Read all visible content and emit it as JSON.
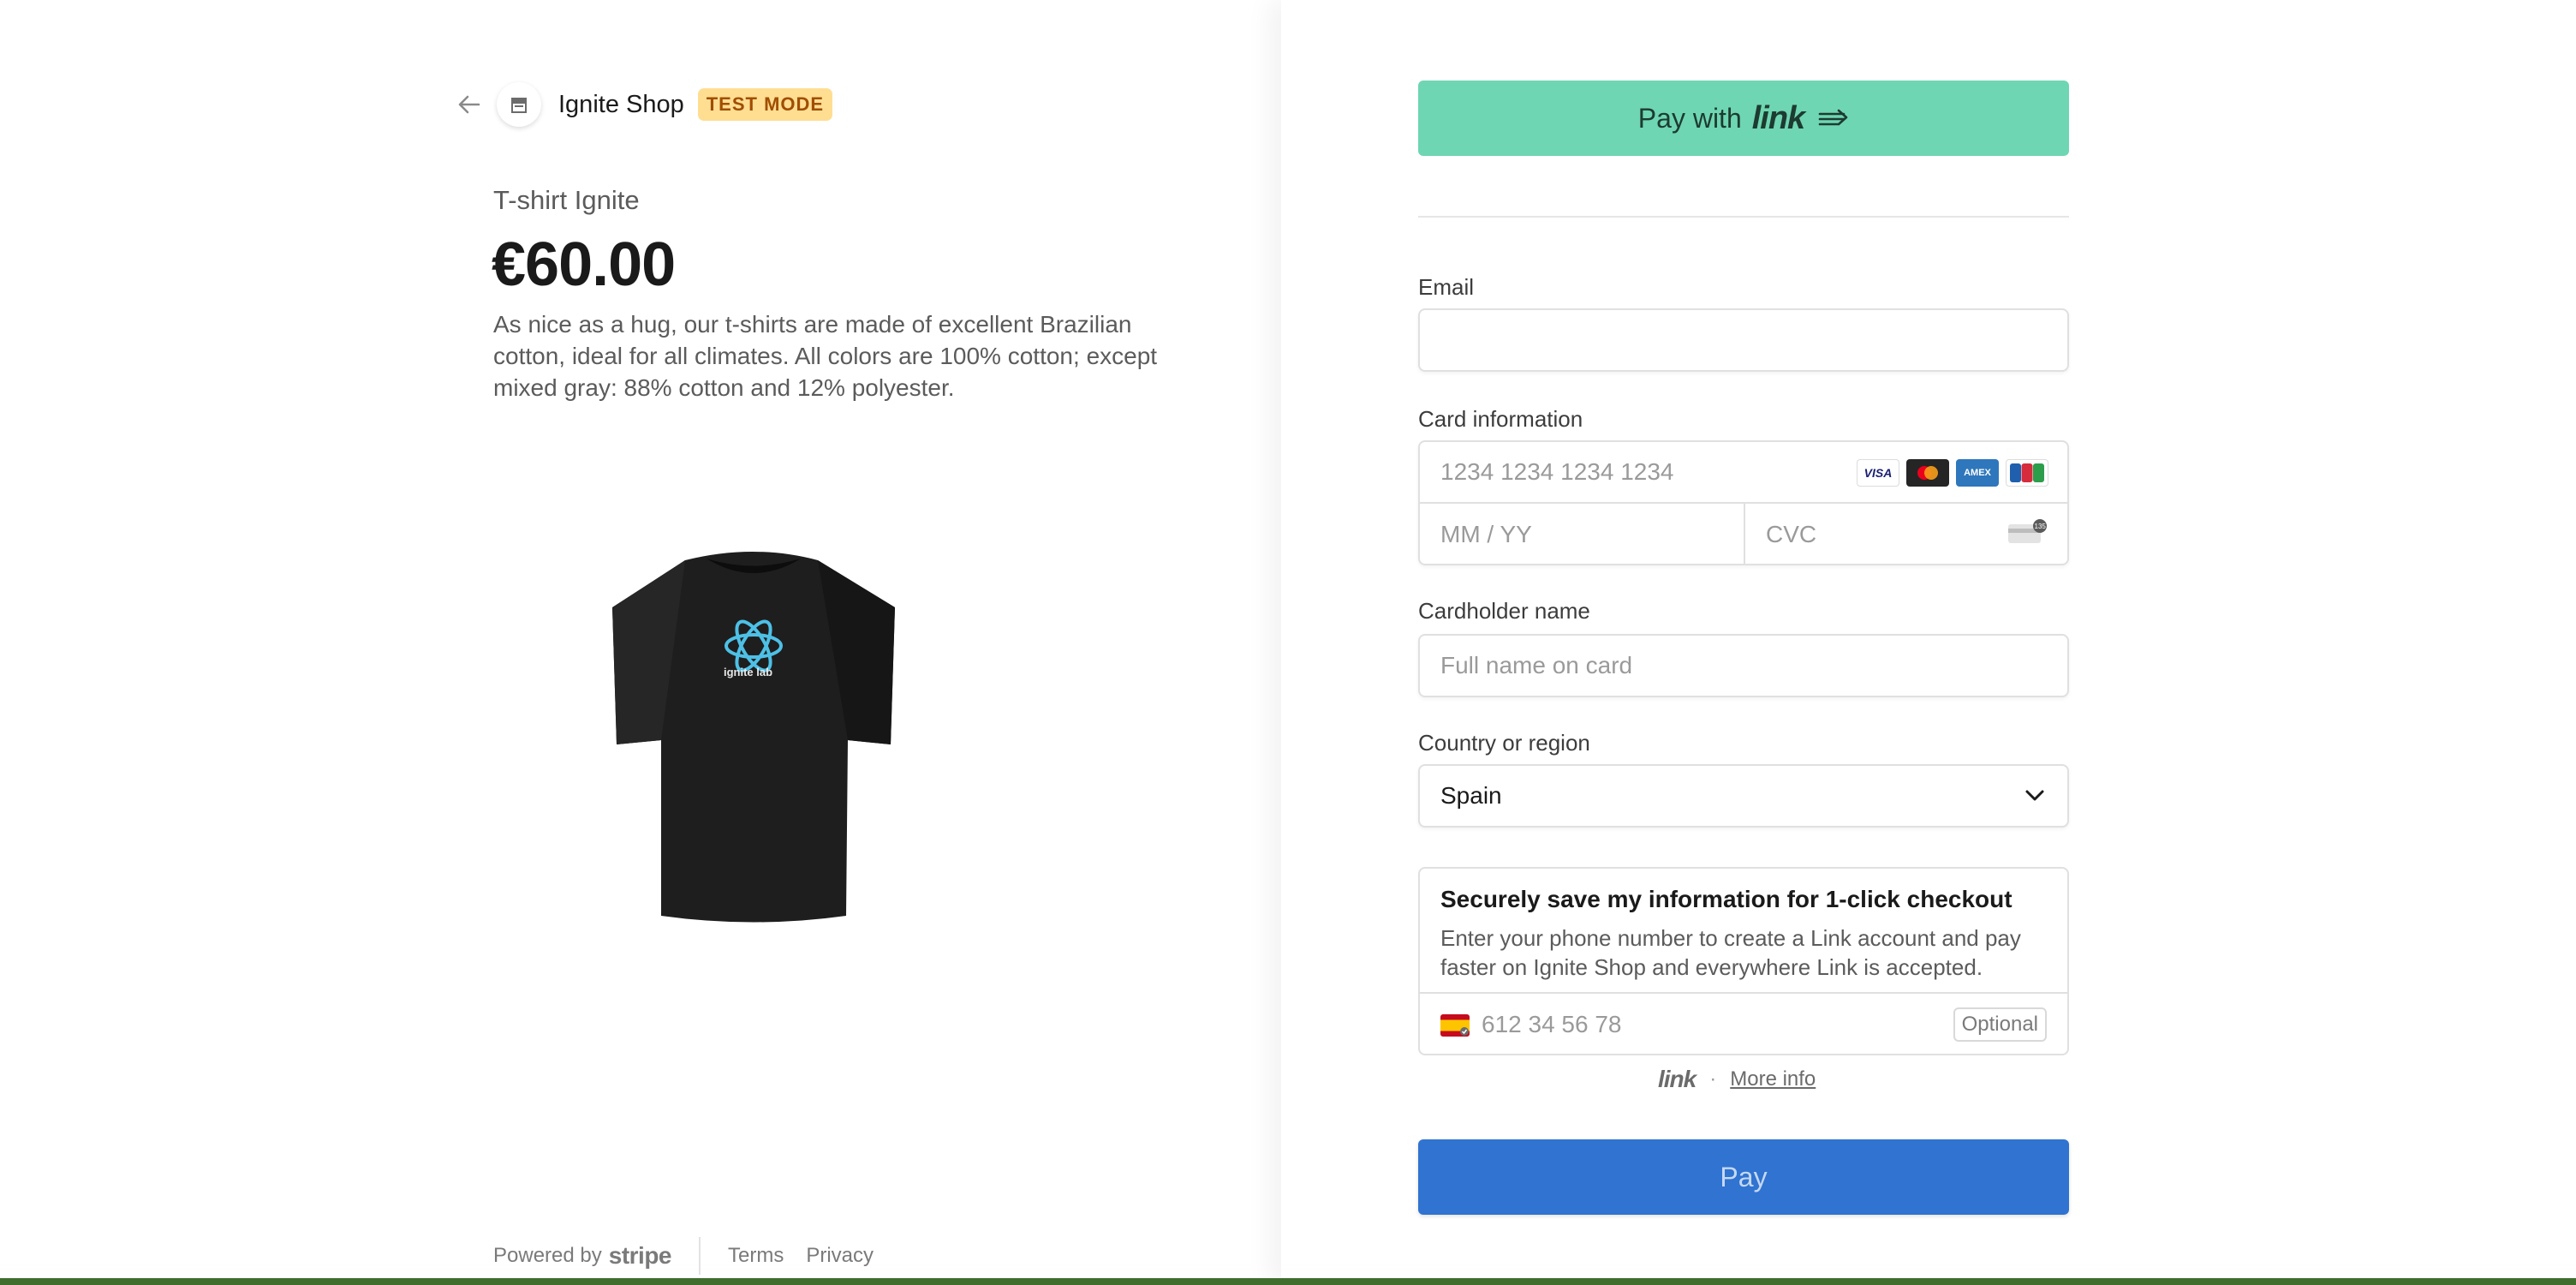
{
  "header": {
    "shop_name": "Ignite Shop",
    "badge": "TEST MODE"
  },
  "product": {
    "name": "T-shirt Ignite",
    "price": "€60.00",
    "description": "As nice as a hug, our t-shirts are made of excellent Brazilian cotton, ideal for all climates. All colors are 100% cotton; except mixed gray: 88% cotton and 12% polyester.",
    "image_logo_text": "ignite lab"
  },
  "footer": {
    "powered_by": "Powered by",
    "stripe": "stripe",
    "terms": "Terms",
    "privacy": "Privacy"
  },
  "link_button": {
    "label": "Pay with",
    "brand": "link"
  },
  "form": {
    "email_label": "Email",
    "email_value": "",
    "card_label": "Card information",
    "card_number_placeholder": "1234 1234 1234 1234",
    "expiry_placeholder": "MM / YY",
    "cvc_placeholder": "CVC",
    "card_brands": [
      "VISA",
      "Mastercard",
      "AMEX",
      "JCB"
    ],
    "cvc_badge": "135",
    "cardholder_label": "Cardholder name",
    "cardholder_placeholder": "Full name on card",
    "country_label": "Country or region",
    "country_value": "Spain"
  },
  "save_info": {
    "title": "Securely save my information for 1-click checkout",
    "description": "Enter your phone number to create a Link account and pay faster on Ignite Shop and everywhere Link is accepted.",
    "phone_placeholder": "612 34 56 78",
    "optional": "Optional"
  },
  "link_footer": {
    "brand": "link",
    "separator": "·",
    "more_info": "More info"
  },
  "pay_button": {
    "label": "Pay"
  },
  "colors": {
    "link_green": "#6ed6b2",
    "pay_blue": "#3073d0",
    "badge_bg": "#ffde92",
    "badge_text": "#a04e00"
  }
}
